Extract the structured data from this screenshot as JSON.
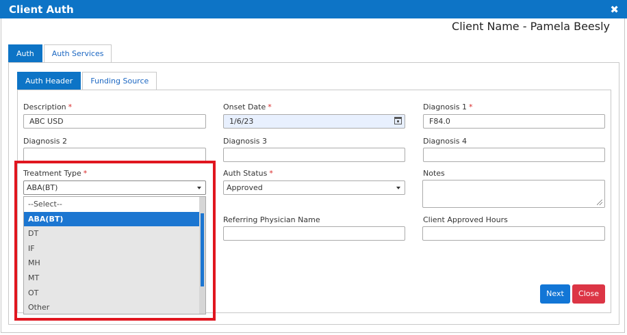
{
  "dialog": {
    "title": "Client Auth",
    "close_glyph": "✖"
  },
  "client_name": "Client Name - Pamela Beesly",
  "outer_tabs": [
    "Auth",
    "Auth Services"
  ],
  "inner_tabs": [
    "Auth Header",
    "Funding Source"
  ],
  "fields": {
    "description": {
      "label": "Description",
      "value": "ABC USD",
      "required": "*"
    },
    "onset_date": {
      "label": "Onset Date",
      "value": "1/6/23",
      "required": "*"
    },
    "diagnosis1": {
      "label": "Diagnosis 1",
      "value": "F84.0",
      "required": "*"
    },
    "diagnosis2": {
      "label": "Diagnosis 2",
      "value": ""
    },
    "diagnosis3": {
      "label": "Diagnosis 3",
      "value": ""
    },
    "diagnosis4": {
      "label": "Diagnosis 4",
      "value": ""
    },
    "treatment_type": {
      "label": "Treatment Type",
      "value": "ABA(BT)",
      "required": "*"
    },
    "auth_status": {
      "label": "Auth Status",
      "value": "Approved",
      "required": "*"
    },
    "notes": {
      "label": "Notes",
      "value": ""
    },
    "referring_physician": {
      "label": "Referring Physician Name",
      "value": ""
    },
    "client_approved_hours": {
      "label": "Client Approved Hours",
      "value": ""
    }
  },
  "treatment_options": [
    "--Select--",
    "ABA(BT)",
    "DT",
    "IF",
    "MH",
    "MT",
    "OT",
    "Other"
  ],
  "selected_treatment_index": 1,
  "buttons": {
    "next": "Next",
    "close": "Close"
  },
  "colors": {
    "primary": "#0d74c6",
    "danger": "#dc3545",
    "required": "#d92828",
    "highlight": "#e0161f",
    "option_selected": "#1c76d1"
  }
}
